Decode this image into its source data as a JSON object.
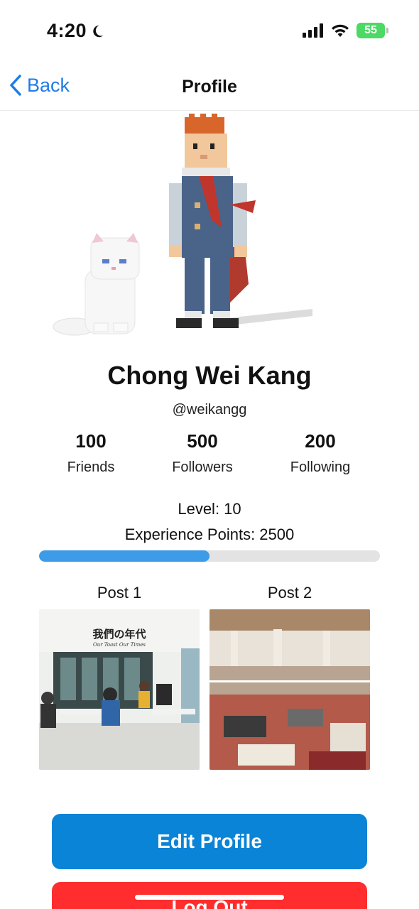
{
  "status_bar": {
    "time": "4:20",
    "battery": "55"
  },
  "nav": {
    "back_label": "Back",
    "title": "Profile"
  },
  "profile": {
    "name": "Chong Wei Kang",
    "username": "@weikangg",
    "stats": [
      {
        "value": "100",
        "label": "Friends"
      },
      {
        "value": "500",
        "label": "Followers"
      },
      {
        "value": "200",
        "label": "Following"
      }
    ],
    "level_text": "Level: 10",
    "xp_text": "Experience Points: 2500",
    "xp_progress": 0.5
  },
  "posts": [
    {
      "title": "Post 1",
      "sign_text": "我們の年代",
      "sign_subtext": "Our Toast Our Times"
    },
    {
      "title": "Post 2"
    }
  ],
  "buttons": {
    "edit_label": "Edit Profile",
    "logout_label": "Log Out"
  },
  "colors": {
    "accent": "#0a84d6",
    "danger": "#ff2d2d",
    "progress": "#3d9be8",
    "link": "#1e7ce6"
  }
}
